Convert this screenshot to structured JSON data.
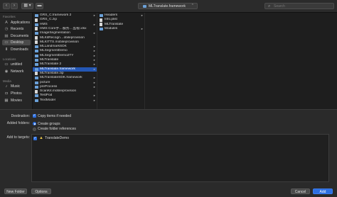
{
  "toolbar": {
    "back_glyph": "‹",
    "forward_glyph": "›",
    "view_glyph": "▦ ▾",
    "group_glyph": "▬",
    "path_label": "MLTranslate.framework",
    "path_chevron": "⌃",
    "search_placeholder": "Search"
  },
  "sidebar": {
    "favorites_heading": "Favorites",
    "favorites": [
      {
        "label": "Applications",
        "icon": "applications-icon",
        "glyph": "A"
      },
      {
        "label": "Recents",
        "icon": "clock-icon",
        "glyph": "◷"
      },
      {
        "label": "Documents",
        "icon": "document-icon",
        "glyph": "▤"
      },
      {
        "label": "Desktop",
        "icon": "desktop-icon",
        "glyph": "▭"
      },
      {
        "label": "Downloads",
        "icon": "download-icon",
        "glyph": "⬇"
      }
    ],
    "locations_heading": "Locations",
    "locations": [
      {
        "label": "untitled",
        "icon": "disk-icon",
        "glyph": "▭"
      },
      {
        "label": "Network",
        "icon": "globe-icon",
        "glyph": "◉"
      }
    ],
    "media_heading": "Media",
    "media": [
      {
        "label": "Music",
        "icon": "music-icon",
        "glyph": "♪"
      },
      {
        "label": "Photos",
        "icon": "camera-icon",
        "glyph": "◘"
      },
      {
        "label": "Movies",
        "icon": "film-icon",
        "glyph": "▦"
      }
    ]
  },
  "columns": {
    "col1": [
      {
        "label": "GRS_C.framework 2",
        "type": "folder"
      },
      {
        "label": "GRS_C.zip",
        "type": "file"
      },
      {
        "label": "HMS",
        "type": "folder"
      },
      {
        "label": "HMS Core手…服务…监视.xlsx",
        "type": "file"
      },
      {
        "label": "ImageSegmentation",
        "type": "folder"
      },
      {
        "label": "MLKitRecogn…obileprovision",
        "type": "file"
      },
      {
        "label": "MLKITTS.mobileprovision",
        "type": "file"
      },
      {
        "label": "MLLandmarkSDK",
        "type": "folder"
      },
      {
        "label": "MLSegmentDemo",
        "type": "folder"
      },
      {
        "label": "MLSegmentDemo2TY",
        "type": "folder"
      },
      {
        "label": "MLTranslate",
        "type": "folder"
      },
      {
        "label": "MLTranslate 2",
        "type": "folder"
      },
      {
        "label": "MLTranslate.framework",
        "type": "folder"
      },
      {
        "label": "MLTranslate.zip",
        "type": "file"
      },
      {
        "label": "MLTranslateSDK.framework",
        "type": "folder"
      },
      {
        "label": "picture",
        "type": "folder"
      },
      {
        "label": "preProcess",
        "type": "folder"
      },
      {
        "label": "ScanKit.mobileprovision",
        "type": "file"
      },
      {
        "label": "TestPod",
        "type": "folder"
      },
      {
        "label": "TextModel",
        "type": "folder"
      }
    ],
    "col2": [
      {
        "label": "Headers",
        "type": "folder",
        "arrow": true
      },
      {
        "label": "Info.plist",
        "type": "file",
        "arrow": false
      },
      {
        "label": "MLTranslate",
        "type": "file",
        "arrow": false
      },
      {
        "label": "Modules",
        "type": "folder",
        "arrow": true
      }
    ],
    "arrow_glyph": "▸"
  },
  "options": {
    "destination_label": "Destination:",
    "copy_items_label": "Copy items if needed",
    "added_folders_label": "Added folders:",
    "create_groups_label": "Create groups",
    "create_folder_refs_label": "Create folder references",
    "add_to_targets_label": "Add to targets:",
    "target_name": "TranslateDemo",
    "check_glyph": "✓",
    "app_glyph": "▲"
  },
  "bottom": {
    "new_folder": "New Folder",
    "options": "Options",
    "cancel": "Cancel",
    "add": "Add"
  }
}
